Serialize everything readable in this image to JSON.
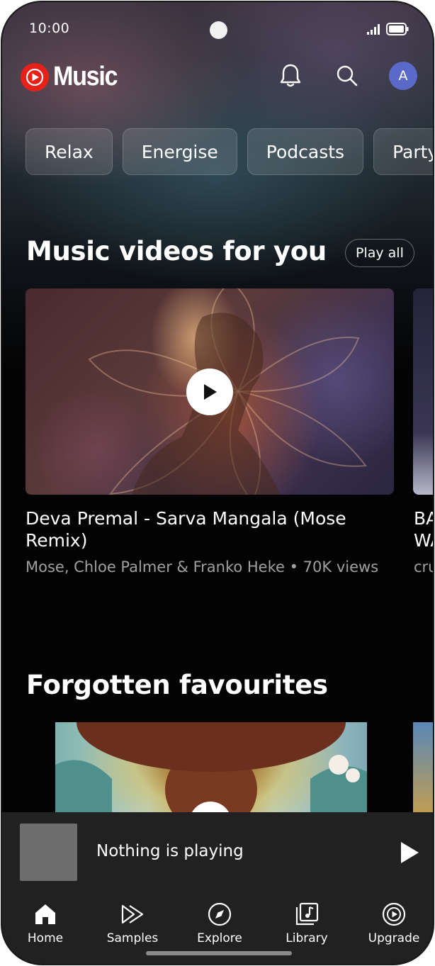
{
  "status_bar": {
    "time": "10:00"
  },
  "header": {
    "app_name": "Music",
    "avatar_initial": "A"
  },
  "chips": [
    "Relax",
    "Energise",
    "Podcasts",
    "Party"
  ],
  "music_videos": {
    "title": "Music videos for you",
    "play_all_label": "Play all",
    "items": [
      {
        "title": "Deva Premal - Sarva Mangala (Mose Remix)",
        "subtitle": "Mose, Chloe Palmer & Franko Heke • 70K views"
      },
      {
        "title": "BA\nWA",
        "subtitle": "cru"
      }
    ]
  },
  "forgotten_favourites": {
    "title": "Forgotten favourites"
  },
  "mini_player": {
    "title": "Nothing is playing"
  },
  "bottom_nav": [
    {
      "label": "Home",
      "icon": "home-icon"
    },
    {
      "label": "Samples",
      "icon": "samples-icon"
    },
    {
      "label": "Explore",
      "icon": "compass-icon"
    },
    {
      "label": "Library",
      "icon": "library-icon"
    },
    {
      "label": "Upgrade",
      "icon": "upgrade-icon"
    }
  ],
  "colors": {
    "logo_red": "#e62117",
    "avatar": "#5b6ac8",
    "background": "#030303",
    "bar": "#212121"
  }
}
